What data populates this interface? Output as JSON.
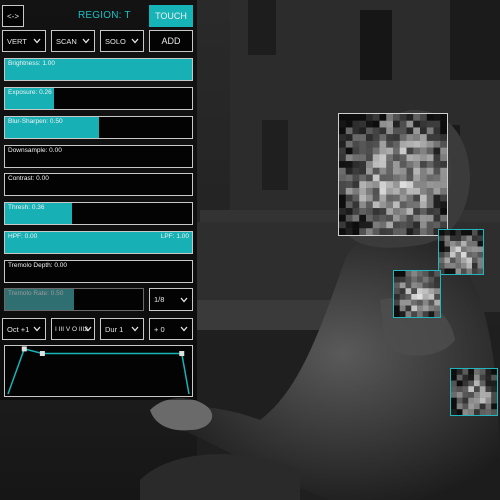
{
  "header": {
    "toggle_label": "<->",
    "region_title": "REGION: T",
    "touch_label": "TOUCH"
  },
  "toolbar": {
    "vert": "VERT",
    "scan": "SCAN",
    "solo": "SOLO",
    "add_label": "ADD"
  },
  "sliders": {
    "brightness": {
      "label": "Brightness: 1.00",
      "value": 1.0
    },
    "exposure": {
      "label": "Exposure: 0.26",
      "value": 0.26
    },
    "blur_sharpen": {
      "label": "Blur-Sharpen: 0.50",
      "value": 0.5
    },
    "downsample": {
      "label": "Downsample: 0.00",
      "value": 0.0
    },
    "contrast": {
      "label": "Contrast: 0.00",
      "value": 0.0
    },
    "thresh": {
      "label": "Thresh: 0.36",
      "value": 0.36
    },
    "filter": {
      "hpf_label": "HPF: 0.00",
      "lpf_label": "LPF: 1.00",
      "hpf": 0.0,
      "lpf": 1.0
    },
    "tremolo_depth": {
      "label": "Tremolo Depth: 0.00",
      "value": 0.0
    },
    "tremolo_rate": {
      "label": "Tremolo Rate: 0.50",
      "value": 0.5
    }
  },
  "rate_division": "1/8",
  "music": {
    "octave": "Oct +1",
    "progression": "I III V O III2",
    "duration": "Dur 1",
    "transpose": "+ 0"
  },
  "envelope": {
    "points": [
      [
        0.0,
        0.0
      ],
      [
        0.09,
        0.98
      ],
      [
        0.19,
        0.88
      ],
      [
        0.96,
        0.88
      ],
      [
        1.0,
        0.0
      ]
    ]
  },
  "colors": {
    "accent": "#16b3b7",
    "panel_border": "#c8c8c8"
  },
  "regions": [
    {
      "name": "face-region",
      "kind": "face"
    },
    {
      "name": "hand-region-1",
      "kind": "hand"
    },
    {
      "name": "arm-region-2",
      "kind": "hand"
    },
    {
      "name": "knee-region-3",
      "kind": "hand"
    }
  ]
}
